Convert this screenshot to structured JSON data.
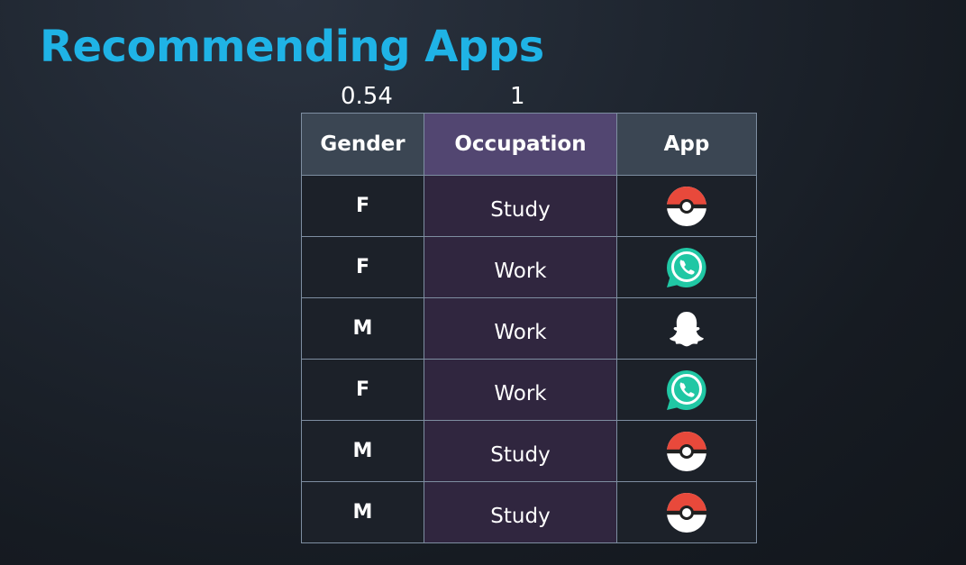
{
  "slide": {
    "title": "Recommending Apps"
  },
  "scores": {
    "gender": "0.54",
    "occupation": "1"
  },
  "table": {
    "headers": {
      "gender": "Gender",
      "occupation": "Occupation",
      "app": "App"
    },
    "rows": [
      {
        "gender": "F",
        "occupation": "Study",
        "app": "pokeball-icon"
      },
      {
        "gender": "F",
        "occupation": "Work",
        "app": "whatsapp-icon"
      },
      {
        "gender": "M",
        "occupation": "Work",
        "app": "snapchat-icon"
      },
      {
        "gender": "F",
        "occupation": "Work",
        "app": "whatsapp-icon"
      },
      {
        "gender": "M",
        "occupation": "Study",
        "app": "pokeball-icon"
      },
      {
        "gender": "M",
        "occupation": "Study",
        "app": "pokeball-icon"
      }
    ]
  },
  "colors": {
    "title": "#1fb3e6",
    "header_background": "#3b4653",
    "occupation_header_background": "#524671",
    "occupation_column_background": "#30263f",
    "cell_background": "#1c2129",
    "grid_lines": "#7e8ea1",
    "pokeball_red": "#e8493b",
    "whatsapp_green": "#20c7a4"
  }
}
